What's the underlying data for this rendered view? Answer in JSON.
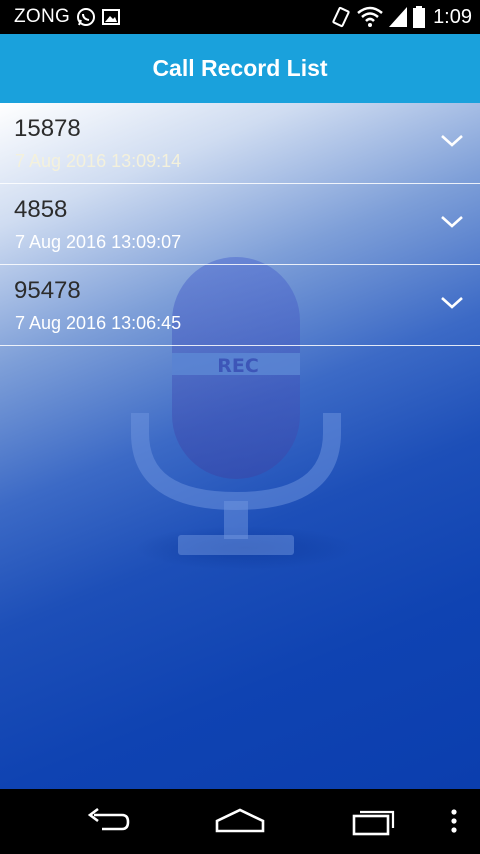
{
  "status_bar": {
    "carrier": "ZONG",
    "time": "1:09",
    "icons": [
      "whatsapp-icon",
      "image-notification-icon",
      "vibrate-icon",
      "wifi-icon",
      "cell-signal-icon",
      "battery-icon"
    ]
  },
  "app_bar": {
    "title": "Call Record List"
  },
  "records": [
    {
      "number": "15878",
      "datetime": "7 Aug 2016 13:09:14",
      "date_color": "#f4f1dc"
    },
    {
      "number": "4858",
      "datetime": "7 Aug 2016 13:09:07",
      "date_color": "#ffffff"
    },
    {
      "number": "95478",
      "datetime": "7 Aug 2016 13:06:45",
      "date_color": "#ffffff"
    }
  ],
  "watermark": {
    "label": "REC",
    "icon": "microphone-icon"
  },
  "nav_bar": {
    "icons": [
      "back-icon",
      "home-icon",
      "recent-apps-icon",
      "overflow-menu-icon"
    ]
  },
  "colors": {
    "app_bar": "#1aa1dc",
    "accent": "#0b3eae"
  }
}
